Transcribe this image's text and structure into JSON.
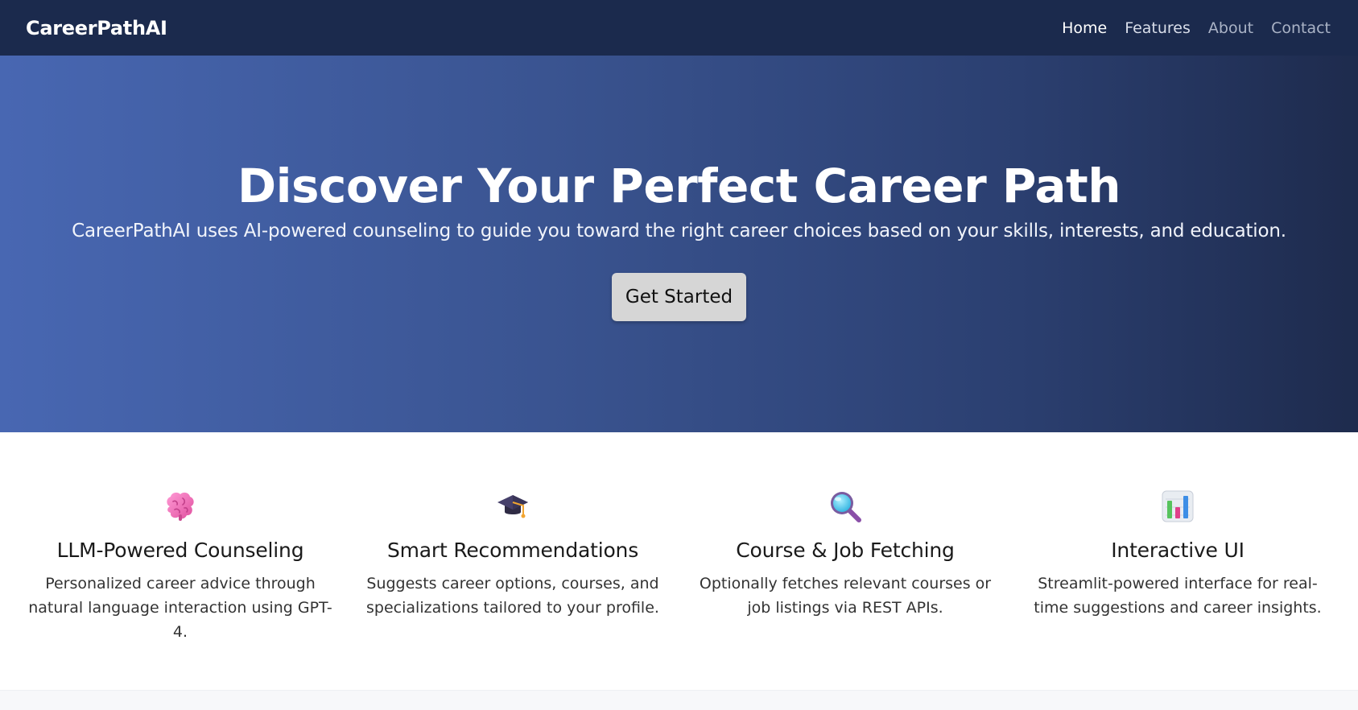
{
  "navbar": {
    "brand": "CareerPathAI",
    "links": [
      {
        "label": "Home"
      },
      {
        "label": "Features"
      },
      {
        "label": "About"
      },
      {
        "label": "Contact"
      }
    ]
  },
  "hero": {
    "title": "Discover Your Perfect Career Path",
    "subtitle": "CareerPathAI uses AI-powered counseling to guide you toward the right career choices based on your skills, interests, and education.",
    "cta_label": "Get Started"
  },
  "features": [
    {
      "icon": "brain-icon",
      "title": "LLM-Powered Counseling",
      "description": "Personalized career advice through natural language interaction using GPT-4."
    },
    {
      "icon": "graduation-cap-icon",
      "title": "Smart Recommendations",
      "description": "Suggests career options, courses, and specializations tailored to your profile."
    },
    {
      "icon": "magnifying-glass-icon",
      "title": "Course & Job Fetching",
      "description": "Optionally fetches relevant courses or job listings via REST APIs."
    },
    {
      "icon": "bar-chart-icon",
      "title": "Interactive UI",
      "description": "Streamlit-powered interface for real-time suggestions and career insights."
    }
  ],
  "colors": {
    "navbar_bg": "#1b2a4d",
    "hero_gradient_start": "#4867b2",
    "hero_gradient_end": "#1e2b4d",
    "cta_bg": "#d6d6d6"
  }
}
